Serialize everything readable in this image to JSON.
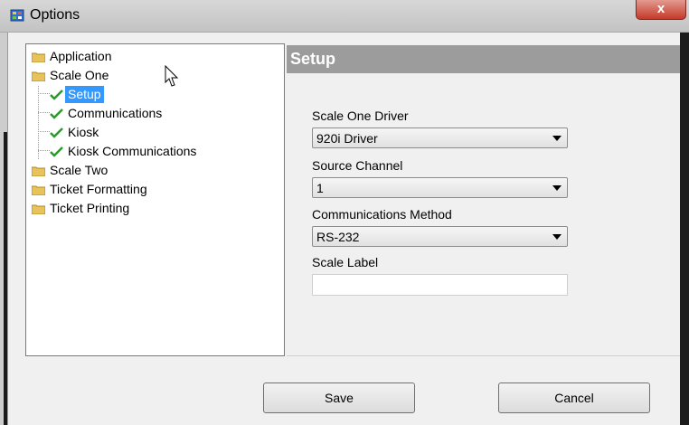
{
  "window": {
    "title": "Options",
    "close_glyph": "x"
  },
  "tree": {
    "nodes": [
      {
        "label": "Application",
        "icon": "folder-icon"
      },
      {
        "label": "Scale One",
        "icon": "folder-icon"
      },
      {
        "label": "Setup",
        "icon": "check-icon",
        "selected": true
      },
      {
        "label": "Communications",
        "icon": "check-icon"
      },
      {
        "label": "Kiosk",
        "icon": "check-icon"
      },
      {
        "label": "Kiosk Communications",
        "icon": "check-icon"
      },
      {
        "label": "Scale Two",
        "icon": "folder-icon"
      },
      {
        "label": "Ticket Formatting",
        "icon": "folder-icon"
      },
      {
        "label": "Ticket Printing",
        "icon": "folder-icon"
      }
    ]
  },
  "setup": {
    "header": "Setup",
    "driver_label": "Scale One Driver",
    "driver_value": "920i Driver",
    "channel_label": "Source Channel",
    "channel_value": "1",
    "method_label": "Communications Method",
    "method_value": "RS-232",
    "scale_label_label": "Scale Label",
    "scale_label_value": ""
  },
  "buttons": {
    "save": "Save",
    "cancel": "Cancel"
  },
  "colors": {
    "selection": "#3399ff",
    "check": "#2a9a2a",
    "header_bg": "#9c9c9c",
    "folder": "#e8c25a"
  }
}
